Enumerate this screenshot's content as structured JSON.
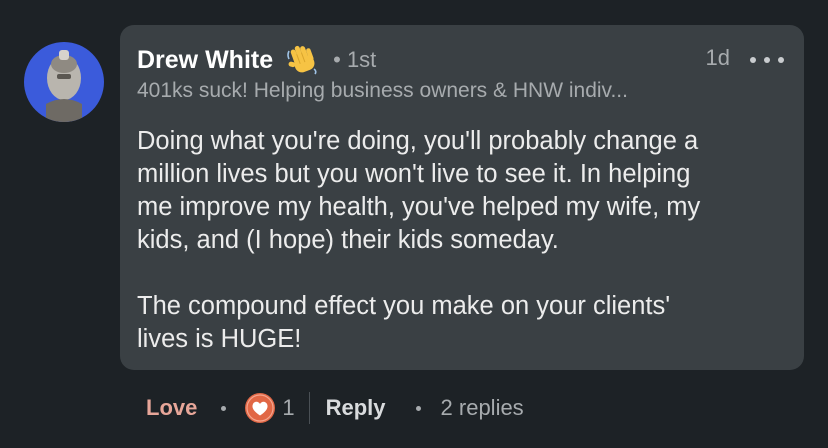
{
  "comment": {
    "author": {
      "name": "Drew White",
      "badge": "wave-emoji",
      "degree": "• 1st",
      "headline": "401ks suck! Helping business owners & HNW indiv..."
    },
    "time": "1d",
    "menu_icon": "more-horizontal-icon",
    "text": "Doing what you're doing, you'll probably change a\nmillion lives but you won't live to see it. In helping\nme improve my health, you've helped my wife, my\nkids, and (I hope) their kids someday.\n\nThe compound effect you make on your clients'\nlives is HUGE!"
  },
  "actions": {
    "love_label": "Love",
    "reaction_icon": "heart-reaction-icon",
    "reaction_count": "1",
    "reply_label": "Reply",
    "replies_label": "2 replies"
  },
  "colors": {
    "background": "#1d2226",
    "bubble": "#3a4044",
    "love": "#e7a699",
    "reaction": "#e16745"
  }
}
